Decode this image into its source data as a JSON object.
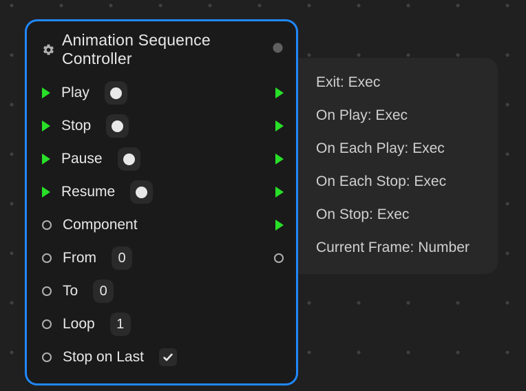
{
  "node": {
    "title": "Animation Sequence Controller",
    "inputs": {
      "play": {
        "label": "Play"
      },
      "stop": {
        "label": "Stop"
      },
      "pause": {
        "label": "Pause"
      },
      "resume": {
        "label": "Resume"
      },
      "component": {
        "label": "Component"
      },
      "from": {
        "label": "From",
        "value": "0"
      },
      "to": {
        "label": "To",
        "value": "0"
      },
      "loop": {
        "label": "Loop",
        "value": "1"
      },
      "stop_on_last": {
        "label": "Stop on Last",
        "checked": true
      }
    },
    "outputs": {
      "exit": {
        "label": "Exit: Exec"
      },
      "on_play": {
        "label": "On Play: Exec"
      },
      "on_each_play": {
        "label": "On Each Play: Exec"
      },
      "on_each_stop": {
        "label": "On Each Stop: Exec"
      },
      "on_stop": {
        "label": "On Stop: Exec"
      },
      "current_frame": {
        "label": "Current Frame: Number"
      }
    }
  }
}
